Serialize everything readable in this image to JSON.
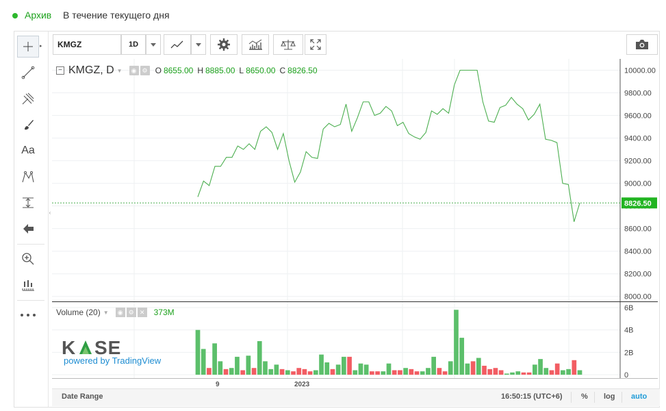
{
  "header": {
    "archive_label": "Архив",
    "period_label": "В течение текущего дня",
    "accent_color": "#2eb82e"
  },
  "toolbar": {
    "symbol": "KMGZ",
    "interval": "1D",
    "icons": [
      "line-chart-icon",
      "gear-icon",
      "indicators-icon",
      "compare-icon",
      "fullscreen-icon",
      "camera-icon"
    ]
  },
  "left_tools": [
    "crosshair-icon",
    "trend-line-icon",
    "pitchfork-icon",
    "brush-icon",
    "text-icon",
    "pattern-icon",
    "measure-icon",
    "arrow-left-icon",
    "zoom-in-icon",
    "bar-replay-icon",
    "more-icon"
  ],
  "left_tools_text": {
    "text_tool": "Aa"
  },
  "legend": {
    "symbol": "KMGZ, D",
    "o_label": "O",
    "o_value": "8655.00",
    "h_label": "H",
    "h_value": "8885.00",
    "l_label": "L",
    "l_value": "8650.00",
    "c_label": "C",
    "c_value": "8826.50"
  },
  "volume_legend": {
    "name": "Volume (20)",
    "value": "373M"
  },
  "logo": {
    "word": "KASE",
    "tagline": "powered by TradingView"
  },
  "time_axis": [
    "9",
    "2023"
  ],
  "bottom_bar": {
    "date_range": "Date Range",
    "clock": "16:50:15 (UTC+6)",
    "percent": "%",
    "log": "log",
    "auto": "auto"
  },
  "chart_data": [
    {
      "type": "line",
      "series": [
        {
          "values": [
            8880,
            9020,
            8980,
            9150,
            9150,
            9230,
            9230,
            9330,
            9300,
            9350,
            9300,
            9460,
            9500,
            9450,
            9300,
            9440,
            9200,
            9010,
            9100,
            9280,
            9230,
            9220,
            9480,
            9530,
            9500,
            9520,
            9700,
            9460,
            9580,
            9720,
            9720,
            9600,
            9620,
            9680,
            9640,
            9510,
            9540,
            9440,
            9410,
            9390,
            9450,
            9640,
            9610,
            9660,
            9620,
            9870,
            10000,
            10000,
            10000,
            10000,
            9720,
            9550,
            9540,
            9670,
            9690,
            9760,
            9700,
            9660,
            9560,
            9610,
            9700,
            9390,
            9380,
            9360,
            9000,
            8990,
            8660,
            8826.5
          ]
        }
      ],
      "price_axis_labels": [
        "10000.00",
        "9800.00",
        "9600.00",
        "9400.00",
        "9200.00",
        "9000.00",
        "8800.00",
        "8600.00",
        "8400.00",
        "8200.00",
        "8000.00"
      ],
      "current_price_label": "8826.50",
      "ylim": [
        7950,
        10100
      ],
      "line_color": "#4caf50",
      "grid": true
    },
    {
      "type": "bar",
      "series": [
        {
          "values": [
            4.0,
            2.3,
            0.6,
            2.8,
            1.2,
            0.5,
            0.6,
            1.6,
            0.4,
            1.7,
            0.6,
            3.0,
            1.2,
            0.5,
            0.9,
            0.5,
            0.4,
            0.3,
            0.6,
            0.5,
            0.3,
            0.4,
            1.8,
            1.1,
            0.5,
            0.9,
            1.6,
            1.6,
            0.4,
            1.0,
            0.9,
            0.3,
            0.3,
            0.3,
            1.0,
            0.4,
            0.4,
            0.6,
            0.5,
            0.3,
            0.3,
            0.6,
            1.6,
            0.6,
            0.3,
            1.2,
            5.8,
            3.3,
            1.0,
            1.2,
            1.5,
            0.8,
            0.5,
            0.6,
            0.4,
            0.1,
            0.2,
            0.3,
            0.2,
            0.2,
            0.9,
            1.4,
            0.6,
            0.4,
            1.0,
            0.4,
            0.5,
            1.3,
            0.4
          ],
          "up": [
            1,
            1,
            0,
            1,
            1,
            0,
            1,
            1,
            0,
            1,
            0,
            1,
            1,
            1,
            1,
            0,
            1,
            0,
            0,
            0,
            0,
            1,
            1,
            1,
            0,
            1,
            1,
            0,
            1,
            1,
            1,
            0,
            0,
            1,
            1,
            0,
            0,
            1,
            0,
            0,
            1,
            1,
            1,
            0,
            0,
            1,
            1,
            1,
            1,
            0,
            1,
            0,
            0,
            0,
            0,
            1,
            1,
            1,
            0,
            0,
            1,
            1,
            1,
            0,
            0,
            1,
            1,
            0,
            1
          ]
        }
      ],
      "axis_labels": [
        "6B",
        "4B",
        "2B",
        "0"
      ],
      "ylim": [
        0,
        6
      ],
      "up_color": "#5cbf6b",
      "down_color": "#f25d63"
    }
  ]
}
